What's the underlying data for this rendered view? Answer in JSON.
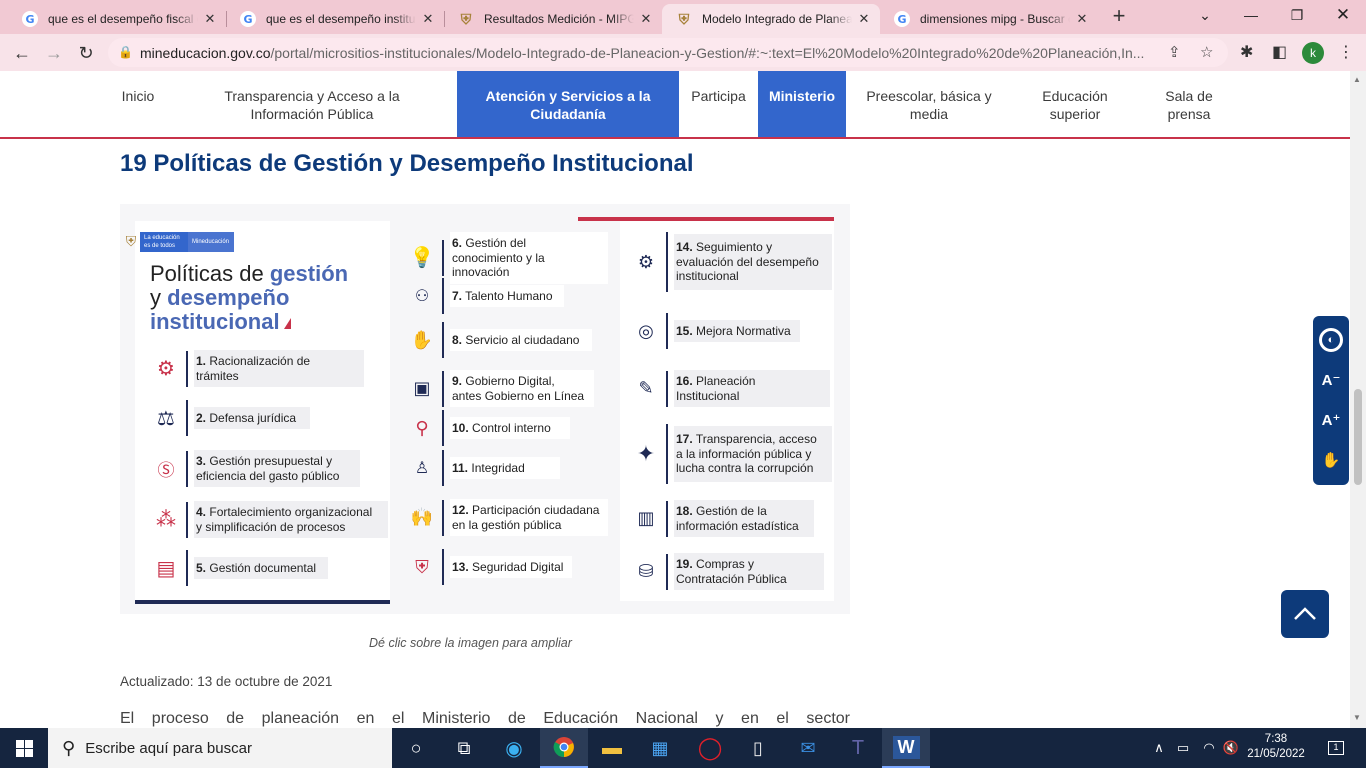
{
  "browser": {
    "tabs": [
      {
        "title": "que es el desempeño fiscal de",
        "favicon": "google-icon",
        "active": false
      },
      {
        "title": "que es el desempeño institucio",
        "favicon": "google-icon",
        "active": false
      },
      {
        "title": "Resultados Medición - MIPG",
        "favicon": "shield-icon",
        "active": false
      },
      {
        "title": "Modelo Integrado de Planea",
        "favicon": "shield-icon",
        "active": true
      },
      {
        "title": "dimensiones mipg - Buscar c",
        "favicon": "google-icon",
        "active": false
      }
    ],
    "new_tab": "+",
    "url_host": "mineducacion.gov.co",
    "url_path": "/portal/micrositios-institucionales/Modelo-Integrado-de-Planeacion-y-Gestion/#:~:text=El%20Modelo%20Integrado%20de%20Planeación,In...",
    "profile_initial": "k"
  },
  "navbar": {
    "items": [
      {
        "label": "Inicio",
        "highlight": false
      },
      {
        "label": "Transparencia y Acceso a la Información Pública",
        "highlight": false
      },
      {
        "label": "Atención y Servicios a la Ciudadanía",
        "highlight": true
      },
      {
        "label": "Participa",
        "highlight": false
      },
      {
        "label": "Ministerio",
        "highlight": true
      },
      {
        "label": "Preescolar, básica y media",
        "highlight": false
      },
      {
        "label": "Educación superior",
        "highlight": false
      },
      {
        "label": "Sala de prensa",
        "highlight": false
      }
    ]
  },
  "page": {
    "title": "19 Políticas de Gestión y Desempeño Institucional",
    "infographic": {
      "logo_line1": "La educación es de todos",
      "logo_line2": "Mineducación",
      "heading_plain1": "Políticas de ",
      "heading_bold1": "gestión",
      "heading_plain2": "y ",
      "heading_bold2": "desempeño",
      "heading_bold3": "institucional",
      "policies": [
        {
          "num": "1.",
          "text": "Racionalización de trámites",
          "icon": "gear-document-icon"
        },
        {
          "num": "2.",
          "text": "Defensa jurídica",
          "icon": "scales-icon"
        },
        {
          "num": "3.",
          "text": "Gestión presupuestal y eficiencia del gasto público",
          "icon": "dollar-icon"
        },
        {
          "num": "4.",
          "text": "Fortalecimiento organizacional y simplificación de procesos",
          "icon": "network-icon"
        },
        {
          "num": "5.",
          "text": "Gestión documental",
          "icon": "document-icon"
        },
        {
          "num": "6.",
          "text": "Gestión del conocimiento y la innovación",
          "icon": "lightbulb-icon"
        },
        {
          "num": "7.",
          "text": "Talento Humano",
          "icon": "people-icon"
        },
        {
          "num": "8.",
          "text": "Servicio al ciudadano",
          "icon": "hand-person-icon"
        },
        {
          "num": "9.",
          "text": "Gobierno Digital, antes Gobierno en Línea",
          "icon": "screen-person-icon"
        },
        {
          "num": "10.",
          "text": "Control interno",
          "icon": "magnifier-icon"
        },
        {
          "num": "11.",
          "text": "Integridad",
          "icon": "integrity-icon"
        },
        {
          "num": "12.",
          "text": "Participación ciudadana en la gestión pública",
          "icon": "raised-hands-icon"
        },
        {
          "num": "13.",
          "text": "Seguridad Digital",
          "icon": "shield-icon"
        },
        {
          "num": "14.",
          "text": "Seguimiento y evaluación del desempeño institucional",
          "icon": "evaluation-icon"
        },
        {
          "num": "15.",
          "text": "Mejora Normativa",
          "icon": "target-icon"
        },
        {
          "num": "16.",
          "text": "Planeación Institucional",
          "icon": "planning-icon"
        },
        {
          "num": "17.",
          "text": "Transparencia, acceso a la información pública y lucha contra la corrupción",
          "icon": "sparkle-icon"
        },
        {
          "num": "18.",
          "text": "Gestión de la información estadística",
          "icon": "chart-icon"
        },
        {
          "num": "19.",
          "text": "Compras y Contratación Pública",
          "icon": "purchase-icon"
        }
      ]
    },
    "caption": "Dé clic sobre la imagen para ampliar",
    "updated": "Actualizado: 13 de octubre de 2021",
    "paragraph": "El proceso de planeación en el Ministerio de Educación Nacional y en el sector"
  },
  "taskbar": {
    "search_placeholder": "Escribe aquí para buscar",
    "time": "7:38",
    "date": "21/05/2022",
    "notifications": "1"
  },
  "colors": {
    "accent_blue": "#3366cc",
    "brand_navy": "#0d3a7a",
    "accent_red": "#c8324a",
    "tabbar_pink": "#f1c9d3"
  }
}
